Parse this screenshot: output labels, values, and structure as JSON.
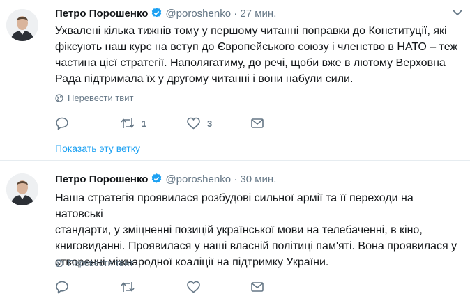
{
  "tweets": [
    {
      "name": "Петро Порошенко",
      "handle": "@poroshenko",
      "separator": "·",
      "time": "27 мин.",
      "lines": [
        "Ухвалені кілька тижнів тому у першому читанні поправки до Конституції, які",
        "фіксують наш курс на вступ до Європейського союзу і членство в НАТО – теж",
        "частина цієї стратегії. Наполягатиму, до речі, щоби вже в лютому Верховна",
        "Рада підтримала їх у другому читанні і вони набули сили."
      ],
      "translate_label": "Перевести твит",
      "reply_count": "",
      "retweet_count": "1",
      "like_count": "3",
      "show_thread": "Показать эту ветку"
    },
    {
      "name": "Петро Порошенко",
      "handle": "@poroshenko",
      "separator": "·",
      "time": "30 мин.",
      "lines": [
        "Наша стратегія проявилася розбудові сильної армії та її переходи на натовські",
        "стандарти, у зміцненні позицій української мови на телебаченні, в кіно,",
        "книговиданні. Проявилася у наші власній політиці пам'яті. Вона проявилася у",
        "створенні міжнародної коаліції на підтримку України."
      ],
      "translate_label": "Перевести твит",
      "reply_count": "",
      "retweet_count": "",
      "like_count": ""
    }
  ],
  "icons": {
    "verified": "verified-badge-icon",
    "more": "chevron-down-icon",
    "translate": "globe-icon",
    "reply": "reply-icon",
    "retweet": "retweet-icon",
    "like": "heart-icon",
    "dm": "envelope-icon"
  },
  "colors": {
    "accent": "#1da1f2",
    "muted": "#657786",
    "text": "#14171a",
    "divider": "#e6ecf0"
  }
}
